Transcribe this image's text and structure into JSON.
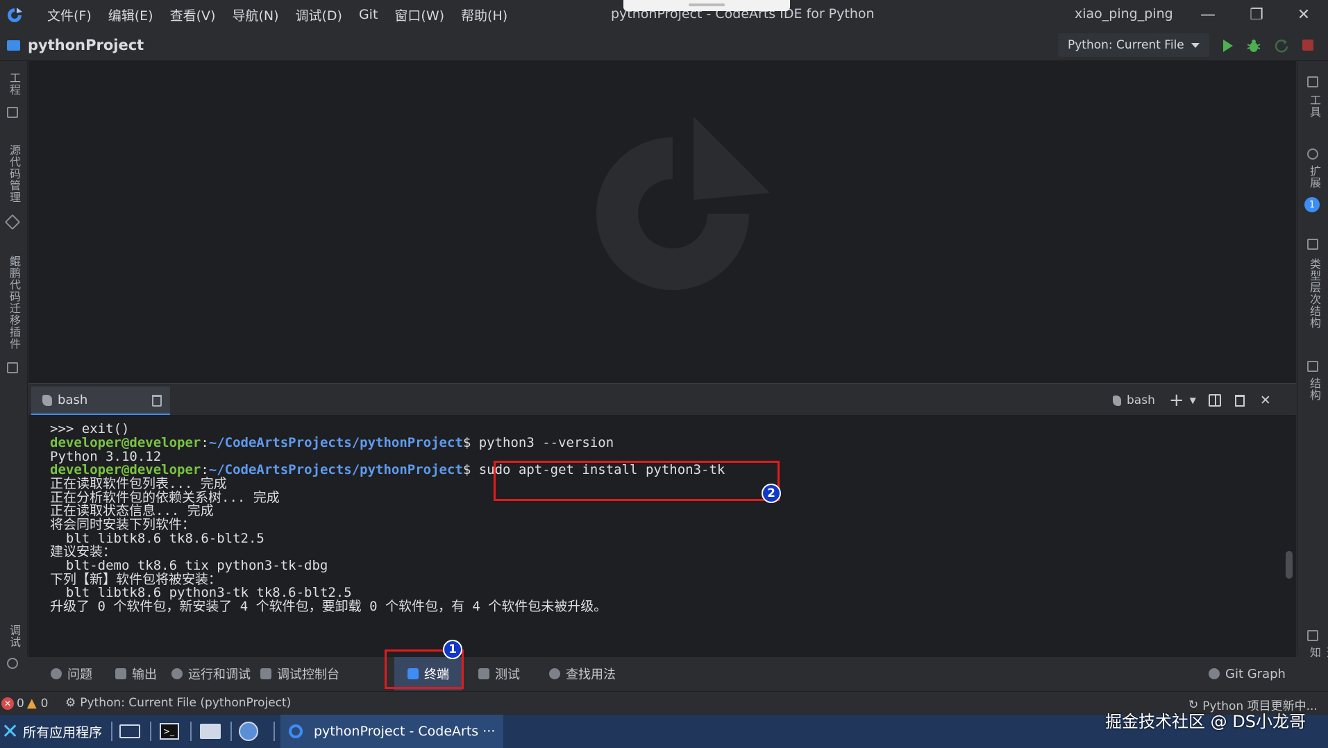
{
  "titlebar": {
    "menu": [
      "文件(F)",
      "编辑(E)",
      "查看(V)",
      "导航(N)",
      "调试(D)",
      "Git",
      "窗口(W)",
      "帮助(H)"
    ],
    "title": "pythonProject - CodeArts IDE for Python",
    "user": "xiao_ping_ping"
  },
  "project": {
    "name": "pythonProject",
    "run_config": "Python: Current File"
  },
  "left_rail": [
    "工程",
    "源代码管理",
    "鲲鹏代码迁移插件",
    "调试"
  ],
  "right_rail": [
    "工具",
    "扩展",
    "类型层次结构",
    "结构",
    "通知"
  ],
  "right_rail_badge": "1",
  "terminal": {
    "tab_label": "bash",
    "right_label": "bash",
    "lines": [
      {
        "type": "text",
        "text": ">>> exit()"
      },
      {
        "type": "prompt",
        "user": "developer@developer",
        "path": "~/CodeArtsProjects/pythonProject",
        "cmd": "$ python3 --version"
      },
      {
        "type": "text",
        "text": "Python 3.10.12"
      },
      {
        "type": "prompt",
        "user": "developer@developer",
        "path": "~/CodeArtsProjects/pythonProject",
        "cmd": "$ sudo apt-get install python3-tk"
      },
      {
        "type": "text",
        "text": "正在读取软件包列表... 完成"
      },
      {
        "type": "text",
        "text": "正在分析软件包的依赖关系树... 完成"
      },
      {
        "type": "text",
        "text": "正在读取状态信息... 完成"
      },
      {
        "type": "text",
        "text": "将会同时安装下列软件："
      },
      {
        "type": "text",
        "text": "  blt libtk8.6 tk8.6-blt2.5"
      },
      {
        "type": "text",
        "text": "建议安装："
      },
      {
        "type": "text",
        "text": "  blt-demo tk8.6 tix python3-tk-dbg"
      },
      {
        "type": "text",
        "text": "下列【新】软件包将被安装："
      },
      {
        "type": "text",
        "text": "  blt libtk8.6 python3-tk tk8.6-blt2.5"
      },
      {
        "type": "text",
        "text": "升级了 0 个软件包，新安装了 4 个软件包，要卸载 0 个软件包，有 4 个软件包未被升级。"
      }
    ]
  },
  "panel_tabs": [
    "问题",
    "输出",
    "运行和调试",
    "调试控制台",
    "终端",
    "测试",
    "查找用法"
  ],
  "panel_active": "终端",
  "git_graph": "Git Graph",
  "status": {
    "errors": "0",
    "warnings": "0",
    "run_file": "Python: Current File (pythonProject)",
    "updating": "Python 项目更新中..."
  },
  "taskbar": {
    "apps": "所有应用程序",
    "window": "pythonProject - CodeArts ···"
  },
  "watermark": "掘金技术社区 @ DS小龙哥",
  "annotations": [
    "1",
    "2"
  ],
  "colors": {
    "accent": "#3d8df5",
    "annotation_red": "#e11b1b",
    "prompt_green": "#7bc441",
    "prompt_blue": "#5e9bf0"
  }
}
